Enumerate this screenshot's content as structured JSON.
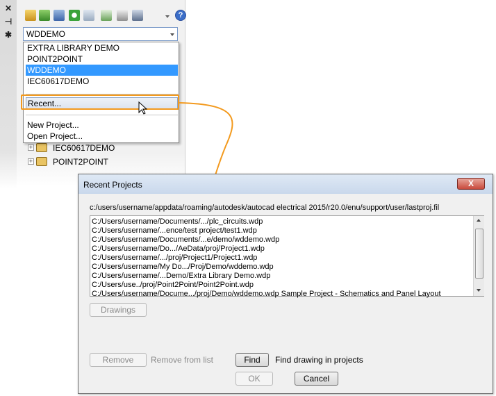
{
  "left_strip": {
    "icons": [
      "close-icon",
      "pin-icon",
      "settings-icon"
    ]
  },
  "palette": {
    "toolbar_icons": [
      "open-project-icon",
      "new-drawing-icon",
      "properties-icon",
      "refresh-icon",
      "update-icon",
      "task-list-icon",
      "publish-icon",
      "plot-icon",
      "help-icon"
    ],
    "help_label": "?",
    "project_combo": {
      "value": "WDDEMO"
    },
    "dropdown": {
      "items": [
        "EXTRA LIBRARY DEMO",
        "POINT2POINT",
        "WDDEMO",
        "IEC60617DEMO"
      ],
      "selected": "WDDEMO",
      "recent": "Recent...",
      "new_project": "New Project...",
      "open_project": "Open Project..."
    },
    "tree": [
      "IEC60617DEMO",
      "POINT2POINT"
    ]
  },
  "dialog": {
    "title": "Recent Projects",
    "close_label": "X",
    "path": "c:/users/username/appdata/roaming/autodesk/autocad electrical 2015/r20.0/enu/support/user/lastproj.fil",
    "projects": [
      "C:/Users/username/Documents/.../plc_circuits.wdp",
      "C:/Users/username/...ence/test project/test1.wdp",
      "C:/Users/username/Documents/...e/demo/wddemo.wdp",
      "C:/Users/username/Do.../AeData/proj/Project1.wdp",
      "C:/Users/username/.../proj/Project1/Project1.wdp",
      "C:/Users/username/My Do.../Proj/Demo/wddemo.wdp",
      "C:/Users/username/...Demo/Extra Library Demo.wdp",
      "C:/Users/use../proj/Point2Point/Point2Point.wdp",
      "C:/Users/username/Docume.../proj/Demo/wddemo.wdp   Sample Project - Schematics and Panel Layout"
    ],
    "drawings_button": "Drawings",
    "remove_button": "Remove",
    "remove_desc": "Remove from list",
    "find_button": "Find",
    "find_desc": "Find drawing in projects",
    "ok_button": "OK",
    "cancel_button": "Cancel"
  },
  "colors": {
    "highlight": "#3399ff",
    "callout": "#f39a1e",
    "close_red": "#c94a3c"
  }
}
